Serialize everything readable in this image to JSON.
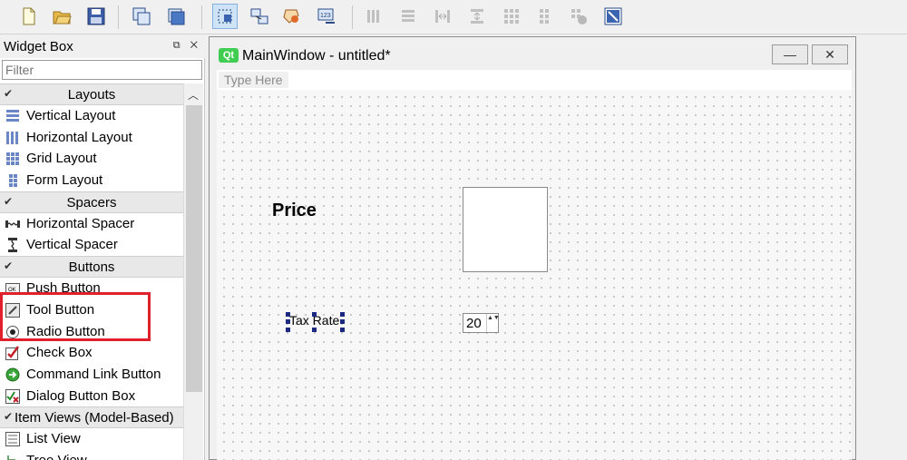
{
  "colors": {
    "highlight": "#e0202a",
    "qt_green": "#41cd52",
    "selection_handle": "#1b2a80"
  },
  "toolbar": {
    "icons": [
      "new-file-icon",
      "open-folder-icon",
      "save-icon",
      "edit-copy-icon",
      "edit-paste-icon",
      "select-widgets-icon",
      "edit-signals-icon",
      "edit-buddies-icon",
      "edit-tab-order-icon",
      "layout-horizontal-icon",
      "layout-vertical-icon",
      "layout-horizontal-splitter-icon",
      "layout-vertical-splitter-icon",
      "layout-grid-icon",
      "layout-form-icon",
      "break-layout-icon",
      "adjust-size-icon"
    ]
  },
  "widget_box": {
    "title": "Widget Box",
    "title_buttons": "⧉ ✕",
    "filter_placeholder": "Filter",
    "categories": {
      "layouts": "Layouts",
      "spacers": "Spacers",
      "buttons": "Buttons",
      "item_views": "Item Views (Model-Based)"
    },
    "items": {
      "vertical_layout": "Vertical Layout",
      "horizontal_layout": "Horizontal Layout",
      "grid_layout": "Grid Layout",
      "form_layout": "Form Layout",
      "horizontal_spacer": "Horizontal Spacer",
      "vertical_spacer": "Vertical Spacer",
      "push_button": "Push Button",
      "tool_button": "Tool Button",
      "radio_button": "Radio Button",
      "check_box": "Check Box",
      "command_link_button": "Command Link Button",
      "dialog_button_box": "Dialog Button Box",
      "list_view": "List View",
      "tree_view": "Tree View"
    }
  },
  "main_window": {
    "logo": "Qt",
    "title": "MainWindow - untitled*",
    "menu_placeholder": "Type Here",
    "minimize": "—",
    "close": "✕"
  },
  "form": {
    "price_label": "Price",
    "tax_label": "Tax Rate",
    "spin_value": "20",
    "spin_arrows": "▲▼"
  }
}
